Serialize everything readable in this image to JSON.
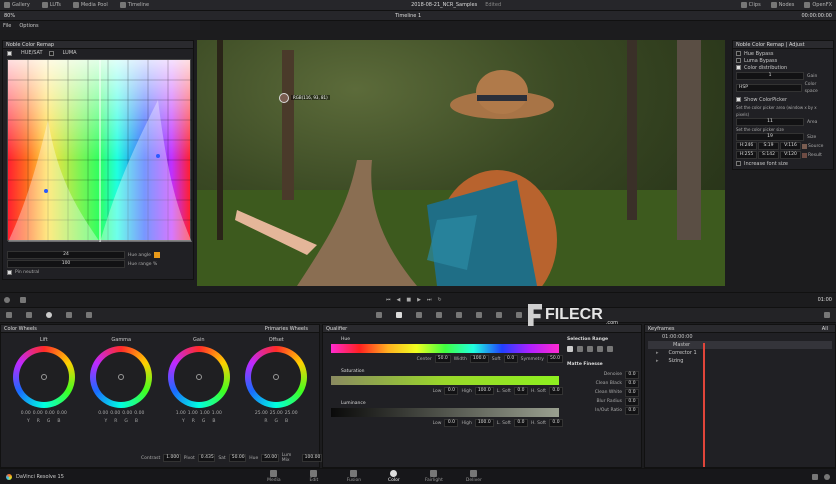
{
  "top_bar": {
    "gallery": "Gallery",
    "luts": "LUTs",
    "media_pool": "Media Pool",
    "timeline": "Timeline",
    "project_title": "2018-08-21_NCR_Samples",
    "edited": "Edited",
    "clips": "Clips",
    "nodes": "Nodes",
    "openfx": "OpenFX"
  },
  "second_bar": {
    "zoom": "80%",
    "timeline_name": "Timeline 1",
    "timecode": "00:00:00:00"
  },
  "menu": {
    "file": "File",
    "options": "Options"
  },
  "remap_panel": {
    "title": "Noble Color Remap",
    "mode_left": "HUE/SAT",
    "mode_right": "LUMA",
    "value_field_1": "24",
    "hue_angle_label": "Hue angle",
    "value_field_2": "100",
    "hue_range_label": "Hue range %",
    "pin_neutral": "Pin neutral"
  },
  "viewer": {
    "picker_readout": "RGB(116, 93, 81)"
  },
  "adjust_panel": {
    "title": "Noble Color Remap | Adjust",
    "hue_bypass": "Hue Bypass",
    "luma_bypass": "Luma Bypass",
    "color_distribution": "Color distribution",
    "gain_value": "1",
    "gain_label": "Gain",
    "color_space_value": "HSP",
    "color_space_label": "Color space",
    "show_colorpicker": "Show ColorPicker",
    "set_area_text": "Set the color picker area (window x by x pixels)",
    "area_value": "11",
    "area_label": "Area",
    "set_size_text": "Set the color picker size",
    "size_value": "19",
    "size_label": "Size",
    "readouts": [
      "H:246",
      "S:19",
      "V:116",
      "H:255",
      "S:142",
      "V:120"
    ],
    "source_label": "Source",
    "result_label": "Result",
    "increase_font": "Increase font size"
  },
  "transport": {
    "timecode_right": "01:00"
  },
  "color_wheels": {
    "title": "Color Wheels",
    "mode": "Primaries Wheels",
    "wheels": [
      {
        "name": "Lift",
        "values": [
          "0.00",
          "0.00",
          "0.00",
          "0.00"
        ]
      },
      {
        "name": "Gamma",
        "values": [
          "0.00",
          "0.00",
          "0.00",
          "0.00"
        ]
      },
      {
        "name": "Gain",
        "values": [
          "1.00",
          "1.00",
          "1.00",
          "1.00"
        ]
      },
      {
        "name": "Offset",
        "values": [
          "25.00",
          "25.00",
          "25.00",
          ""
        ]
      }
    ],
    "channel_labels": [
      "Y",
      "R",
      "G",
      "B"
    ],
    "bottom": {
      "contrast_label": "Contrast",
      "contrast": "1.000",
      "pivot_label": "Pivot",
      "pivot": "0.435",
      "sat_label": "Sat",
      "sat": "50.00",
      "hue_label": "Hue",
      "hue": "50.00",
      "lummix_label": "Lum Mix",
      "lummix": "100.00"
    }
  },
  "qualifier": {
    "title": "Qualifier",
    "hue_title": "Hue",
    "hue_fields": [
      {
        "label": "Center",
        "value": "50.0"
      },
      {
        "label": "Width",
        "value": "100.0"
      },
      {
        "label": "Soft",
        "value": "0.0"
      },
      {
        "label": "Symmetry",
        "value": "50.0"
      }
    ],
    "sat_title": "Saturation",
    "sat_fields": [
      {
        "label": "Low",
        "value": "0.0"
      },
      {
        "label": "High",
        "value": "100.0"
      },
      {
        "label": "L. Soft",
        "value": "0.0"
      },
      {
        "label": "H. Soft",
        "value": "0.0"
      }
    ],
    "lum_title": "Luminance",
    "lum_fields": [
      {
        "label": "Low",
        "value": "0.0"
      },
      {
        "label": "High",
        "value": "100.0"
      },
      {
        "label": "L. Soft",
        "value": "0.0"
      },
      {
        "label": "H. Soft",
        "value": "0.0"
      }
    ],
    "selection_range": "Selection Range",
    "matte_finesse": "Matte Finesse",
    "matte_rows": [
      {
        "label": "Denoise",
        "value": "0.0"
      },
      {
        "label": "Clean Black",
        "value": "0.0"
      },
      {
        "label": "Clean White",
        "value": "0.0"
      },
      {
        "label": "Blur Radius",
        "value": "0.0"
      },
      {
        "label": "In/Out Ratio",
        "value": "0.0"
      }
    ]
  },
  "keyframes": {
    "title": "Keyframes",
    "filter": "All",
    "timecode": "01:00:00:00",
    "tracks": [
      "Master",
      "Corrector 1",
      "Sizing"
    ]
  },
  "watermark": {
    "text": "FILECR",
    "suffix": ".com"
  },
  "bottom_bar": {
    "app_name": "DaVinci Resolve 15",
    "tabs": [
      "Media",
      "Edit",
      "Fusion",
      "Color",
      "Fairlight",
      "Deliver"
    ]
  },
  "colors": {
    "accent": "#e89a1a",
    "background": "#1c1c1e",
    "panel": "#202024",
    "active_tab": "#e0453a"
  }
}
